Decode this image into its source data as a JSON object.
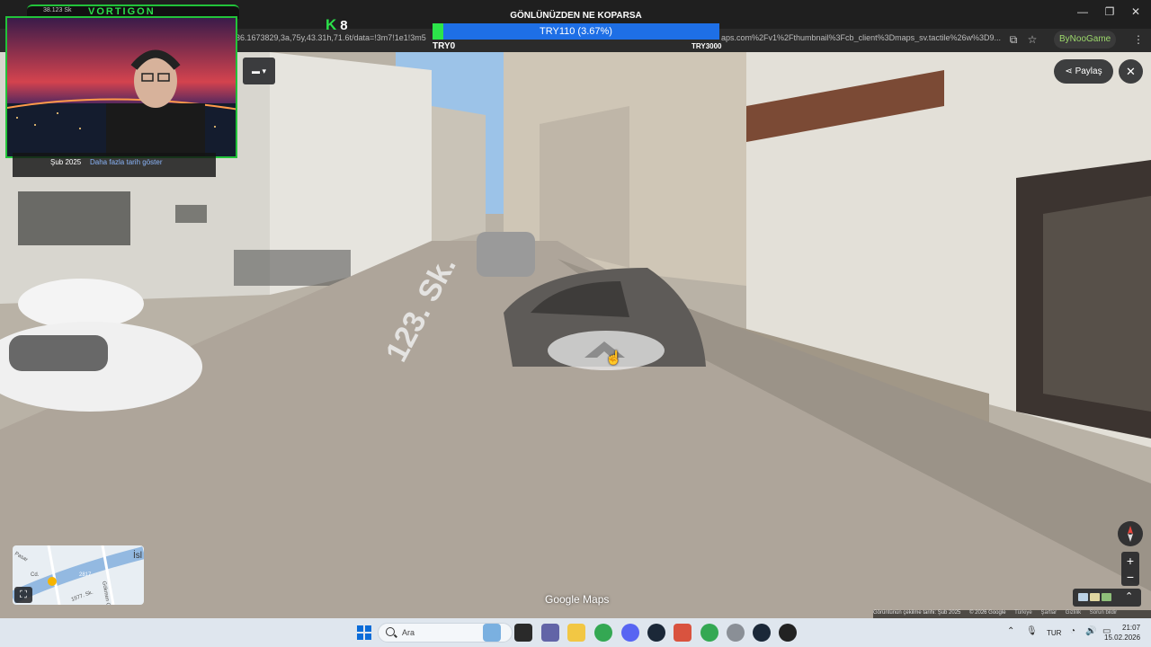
{
  "browser": {
    "url_left": "36.1673829,3a,75y,43.31h,71.6t/data=!3m7!1e1!3m5",
    "url_right": "aps.com%2Fv1%2Fthumbnail%3Fcb_client%3Dmaps_sv.tactile%26w%3D9...",
    "profile_label": "ByNooGame"
  },
  "stream": {
    "channel_name": "VORTIGON",
    "channel_left_text": "38.123 Sk",
    "kick_count": "8",
    "donation_title": "GÖNLÜNÜZDEN NE KOPARSA",
    "donation_progress_text": "TRY110 (3.67%)",
    "donation_progress_fraction": 0.0367,
    "donation_min": "TRY0",
    "donation_max": "TRY3000"
  },
  "streetview": {
    "capture_date": "Şub 2025",
    "more_dates_link": "Daha fazla tarih göster",
    "share_label": "Paylaş",
    "close_label": "✕",
    "street_label": "123. Sk.",
    "minimap_labels": [
      "İsl",
      "Pasar",
      "Cd.",
      "2817",
      "1977. Sk.",
      "Gökmen Cd."
    ],
    "brand": "Google Maps",
    "footer": {
      "capture_label": "Görüntünün çekilme tarihi: Şub 2025",
      "copyright": "© 2026 Google",
      "country": "Türkiye",
      "terms": "Şartlar",
      "privacy": "Gizlilik",
      "report": "Sorun bildir"
    }
  },
  "taskbar": {
    "search_placeholder": "Ara",
    "language": "TUR",
    "time": "21:07",
    "date": "15.02.2026"
  },
  "icons": [
    "search-icon",
    "windows-start-icon",
    "file-explorer-icon",
    "chrome-icon",
    "discord-icon",
    "steam-icon",
    "settings-icon",
    "microphone-icon",
    "wifi-icon",
    "volume-icon",
    "battery-icon",
    "compass-icon",
    "share-icon",
    "close-icon",
    "fullscreen-icon",
    "layers-icon"
  ],
  "colors": {
    "kick_green": "#2be04a",
    "donation_blue": "#1e6fe6",
    "windows_blue": "#0b6cd8"
  }
}
